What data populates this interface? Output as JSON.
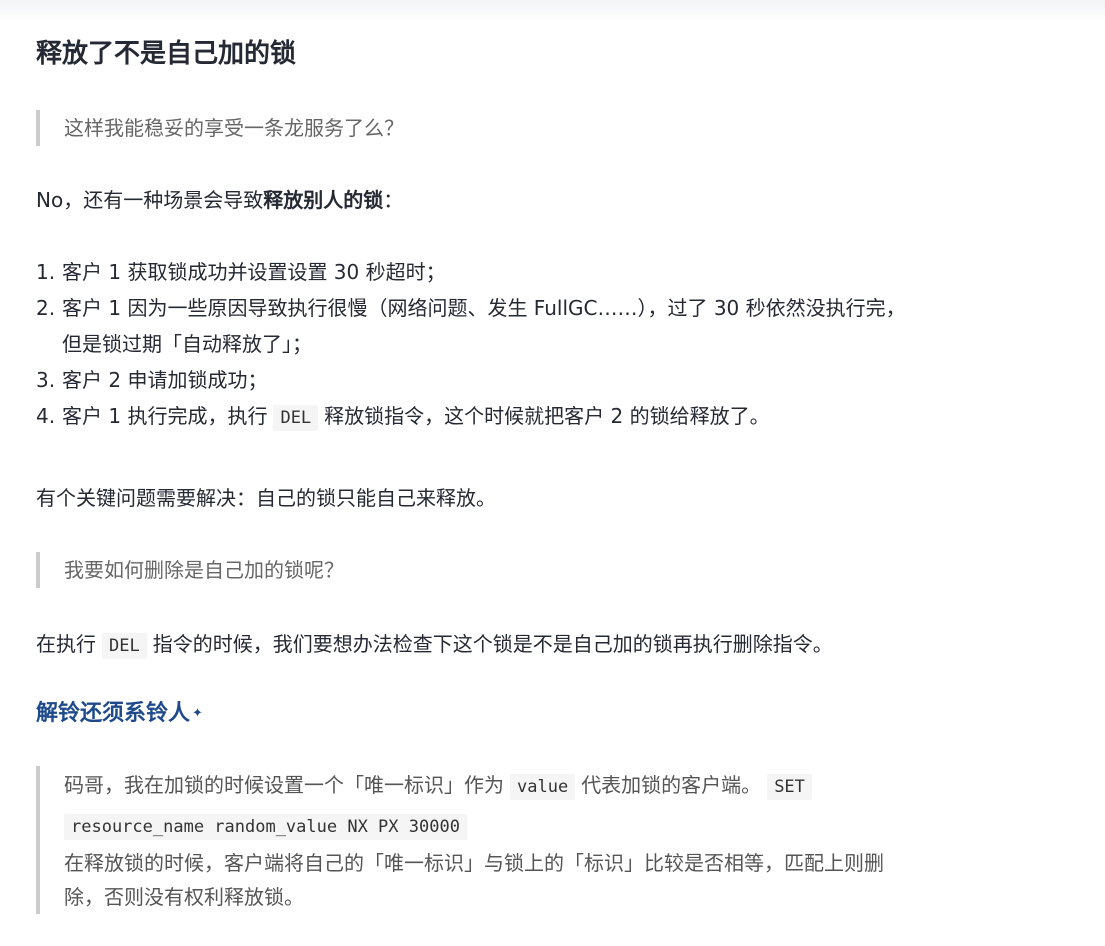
{
  "heading": "释放了不是自己加的锁",
  "quote1": "这样我能稳妥的享受一条龙服务了么？",
  "para1": {
    "prefix": "No，还有一种场景会导致",
    "bold": "释放别人的锁",
    "suffix": "："
  },
  "list": [
    {
      "num": "1.",
      "text": "客户 1 获取锁成功并设置设置 30 秒超时；"
    },
    {
      "num": "2.",
      "text": "客户 1 因为一些原因导致执行很慢（网络问题、发生 FullGC……），过了 30 秒依然没执行完，",
      "text2": "但是锁过期「自动释放了」；"
    },
    {
      "num": "3.",
      "text": "客户 2 申请加锁成功；"
    },
    {
      "num": "4.",
      "text_before": "客户 1 执行完成，执行",
      "code": "DEL",
      "text_after": "释放锁指令，这个时候就把客户 2 的锁给释放了。"
    }
  ],
  "para2": "有个关键问题需要解决：自己的锁只能自己来释放。",
  "quote2": "我要如何删除是自己加的锁呢？",
  "para3": {
    "before": "在执行",
    "code": "DEL",
    "after": "指令的时候，我们要想办法检查下这个锁是不是自己加的锁再执行删除指令。"
  },
  "subheading": "解铃还须系铃人",
  "subheading_mark": "✦",
  "quote3": {
    "line1_before": "码哥，我在加锁的时候设置一个「唯一标识」作为",
    "code1": "value",
    "line1_middle": "代表加锁的客户端。",
    "code2": "SET",
    "code3": "resource_name random_value NX PX 30000",
    "line3": "在释放锁的时候，客户端将自己的「唯一标识」与锁上的「标识」比较是否相等，匹配上则删",
    "line4": "除，否则没有权利释放锁。"
  }
}
